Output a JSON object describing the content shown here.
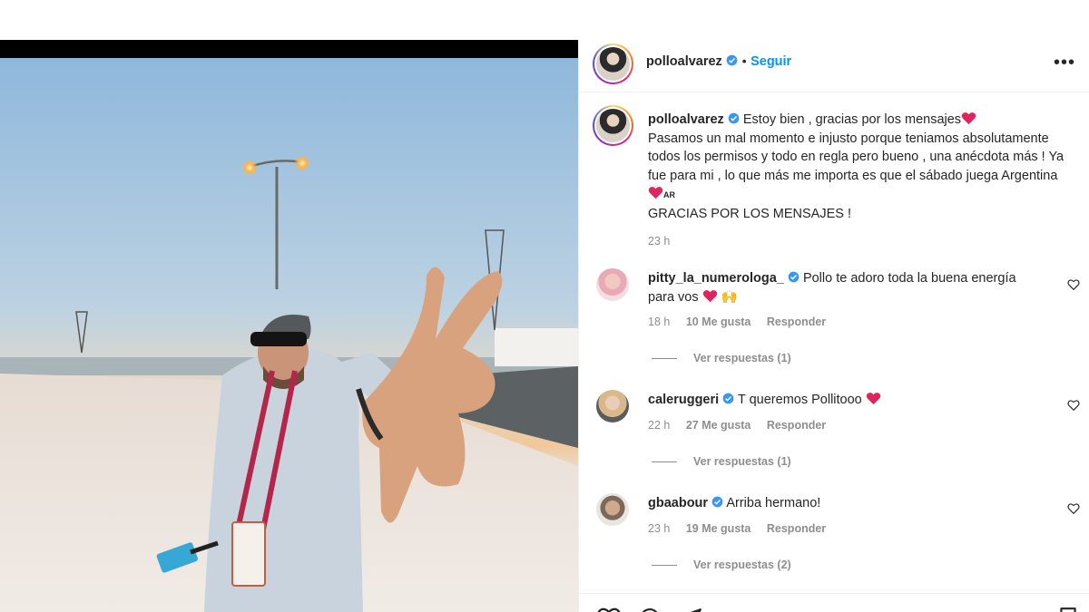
{
  "post": {
    "author": "polloalvarez",
    "follow_label": "Seguir",
    "separator": "•",
    "more_label": "•••"
  },
  "caption": {
    "author": "polloalvarez",
    "text": "Estoy bien , gracias por los mensajes",
    "body": "Pasamos un mal momento e injusto porque teniamos absolutamente todos los permisos y todo en regla pero bueno , una anécdota más ! Ya fue para mi , lo que más me importa es que el sábado juega Argentina",
    "flag_code": "AR",
    "closing": "GRACIAS POR LOS MENSAJES !",
    "time": "23 h"
  },
  "comments": [
    {
      "username": "pitty_la_numerologa_",
      "text_line1": "Pollo te adoro toda la buena energía",
      "text_line2": "para vos",
      "emoji": "🙌",
      "time": "18 h",
      "likes": "10 Me gusta",
      "reply": "Responder",
      "view_replies": "Ver respuestas (1)"
    },
    {
      "username": "caleruggeri",
      "text_line1": "T queremos Pollitooo",
      "time": "22 h",
      "likes": "27 Me gusta",
      "reply": "Responder",
      "view_replies": "Ver respuestas (1)"
    },
    {
      "username": "gbaabour",
      "text_line1": "Arriba hermano!",
      "time": "23 h",
      "likes": "19 Me gusta",
      "reply": "Responder",
      "view_replies": "Ver respuestas (2)"
    }
  ],
  "colors": {
    "link_blue": "#0095f6",
    "verified_blue": "#3897f0",
    "heart_red": "#e0245e",
    "meta_gray": "#8e8e8e"
  },
  "icons": [
    "verified-badge-icon",
    "heart-icon",
    "comment-icon",
    "share-icon",
    "bookmark-icon",
    "more-options-icon"
  ]
}
